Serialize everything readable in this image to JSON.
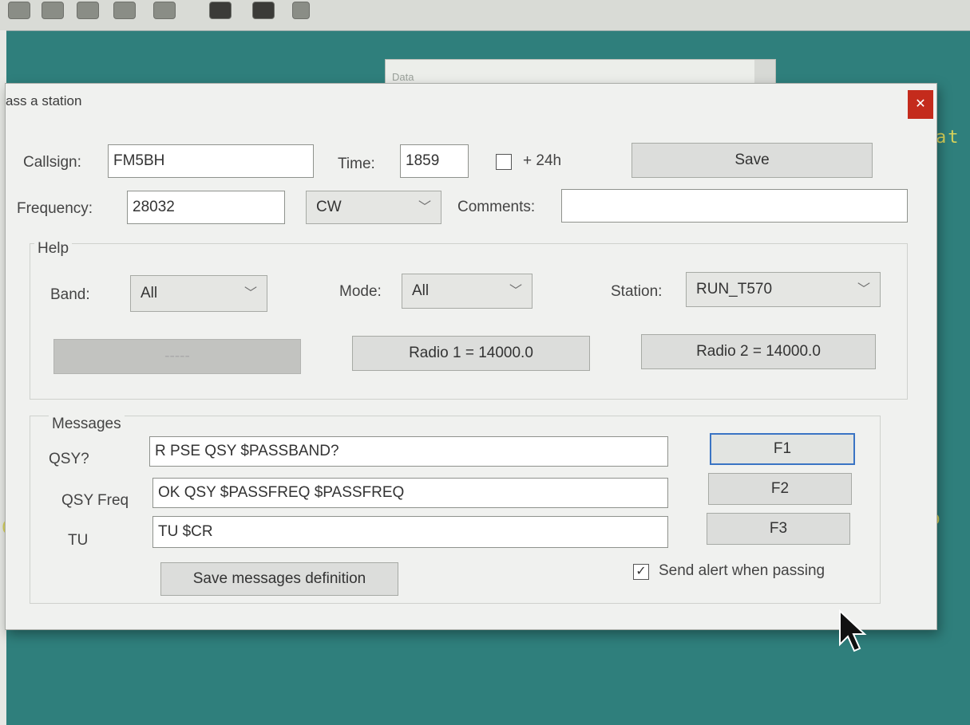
{
  "background": {
    "left_text": "C",
    "right_text_top": "at",
    "right_text_mid": "ato"
  },
  "back_window": {
    "title": "Data"
  },
  "dialog": {
    "title": "ass a station",
    "close_icon": "close-icon",
    "callsign": {
      "label": "Callsign:",
      "value": "FM5BH"
    },
    "time": {
      "label": "Time:",
      "value": "1859"
    },
    "plus24h": {
      "label": "+ 24h",
      "checked": false
    },
    "save_label": "Save",
    "frequency": {
      "label": "Frequency:",
      "value": "28032"
    },
    "mode_select": {
      "value": "CW"
    },
    "comments": {
      "label": "Comments:",
      "value": ""
    },
    "help": {
      "title": "Help",
      "band": {
        "label": "Band:",
        "value": "All"
      },
      "mode": {
        "label": "Mode:",
        "value": "All"
      },
      "station": {
        "label": "Station:",
        "value": "RUN_T570"
      },
      "disabled_button": "-----",
      "radio1": "Radio 1 = 14000.0",
      "radio2": "Radio 2 = 14000.0"
    },
    "messages": {
      "title": "Messages",
      "rows": [
        {
          "label": "QSY?",
          "value": "R PSE QSY $PASSBAND?",
          "key": "F1"
        },
        {
          "label": "QSY Freq",
          "value": "OK QSY $PASSFREQ $PASSFREQ",
          "key": "F2"
        },
        {
          "label": "TU",
          "value": "TU $CR",
          "key": "F3"
        }
      ],
      "save_definition": "Save messages definition",
      "send_alert": {
        "label": "Send alert when passing",
        "checked": true
      }
    }
  }
}
